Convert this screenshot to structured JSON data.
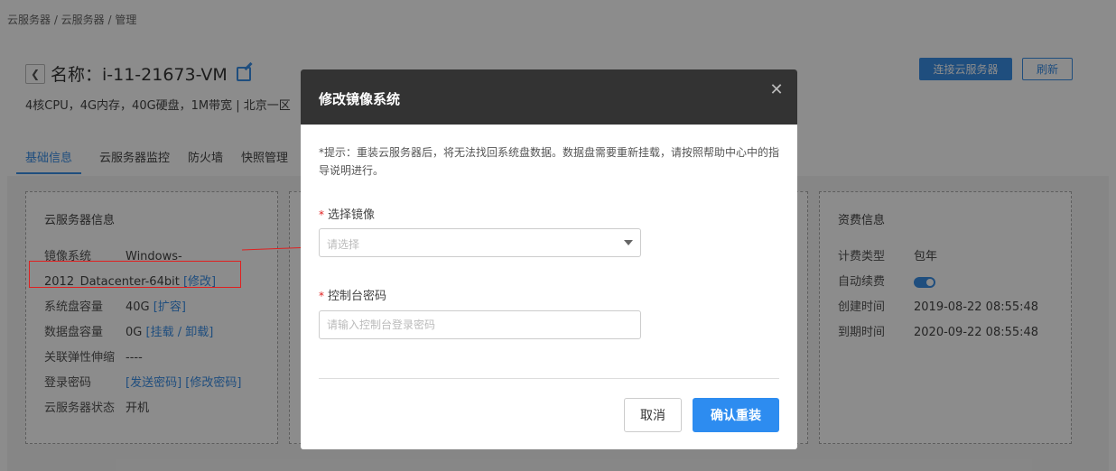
{
  "breadcrumb": "云服务器 / 云服务器 / 管理",
  "header": {
    "title": "名称：i-11-21673-VM",
    "spec": "4核CPU，4G内存，40G硬盘，1M带宽 | 北京一区",
    "connect_label": "连接云服务器",
    "refresh_label": "刷新"
  },
  "tabs": [
    "基础信息",
    "云服务器监控",
    "防火墙",
    "快照管理"
  ],
  "server_info": {
    "title": "云服务器信息",
    "image_key": "镜像系统",
    "image_value_1": "Windows-",
    "image_value_2": "2012_Datacenter-64bit",
    "image_link": "[修改]",
    "disk_key": "系统盘容量",
    "disk_value": "40G",
    "disk_link": "[扩容]",
    "data_disk_key": "数据盘容量",
    "data_disk_value": "0G",
    "data_disk_link": "[挂载 / 卸载]",
    "elastic_key": "关联弹性伸缩",
    "elastic_value": "----",
    "login_key": "登录密码",
    "login_link": "[发送密码] [修改密码]",
    "status_key": "云服务器状态",
    "status_value": "开机"
  },
  "billing_info": {
    "title": "资费信息",
    "type_key": "计费类型",
    "type_value": "包年",
    "renew_key": "自动续费",
    "created_key": "创建时间",
    "created_value": "2019-08-22 08:55:48",
    "expire_key": "到期时间",
    "expire_value": "2020-09-22 08:55:48"
  },
  "modal": {
    "title": "修改镜像系统",
    "tip": "*提示：重装云服务器后，将无法找回系统盘数据。数据盘需要重新挂载，请按照帮助中心中的指导说明进行。",
    "image_label": "选择镜像",
    "image_placeholder": "请选择",
    "password_label": "控制台密码",
    "password_placeholder": "请输入控制台登录密码",
    "cancel_label": "取消",
    "confirm_label": "确认重装",
    "required_mark": "*"
  },
  "colors": {
    "accent": "#3a8ee6",
    "annotation": "#e02020",
    "modal_header": "#333333"
  },
  "icons": {
    "back": "chevron-left-icon",
    "edit": "edit-icon",
    "close": "close-icon",
    "caret": "caret-down-icon"
  }
}
